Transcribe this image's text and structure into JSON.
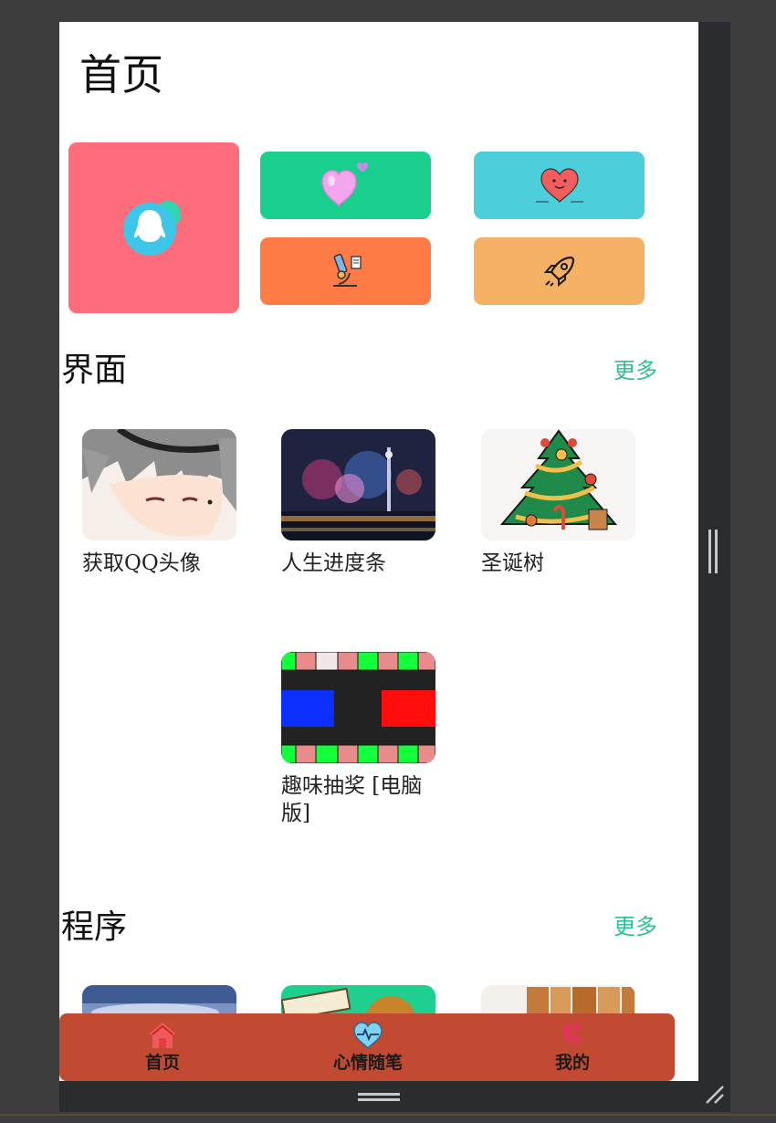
{
  "page": {
    "title": "首页"
  },
  "quick_tiles": [
    {
      "icon": "qq-penguin-icon",
      "color": "#fe6d7c"
    },
    {
      "icon": "pink-heart-icon",
      "color": "#19cf8e"
    },
    {
      "icon": "smiling-heart-icon",
      "color": "#4ccedb"
    },
    {
      "icon": "microscope-icon",
      "color": "#ff7b45"
    },
    {
      "icon": "rocket-icon",
      "color": "#f4b063"
    }
  ],
  "sections": {
    "ui": {
      "title": "界面",
      "more": "更多",
      "items": [
        {
          "label": "获取QQ头像"
        },
        {
          "label": "人生进度条"
        },
        {
          "label": "圣诞树"
        },
        {
          "label": "趣味抽奖 [电脑版]"
        }
      ]
    },
    "program": {
      "title": "程序",
      "more": "更多"
    }
  },
  "tabbar": {
    "color": "#c34a32",
    "tabs": [
      {
        "label": "首页",
        "icon": "home-icon"
      },
      {
        "label": "心情随笔",
        "icon": "heartbeat-icon"
      },
      {
        "label": "我的",
        "icon": "profile-icon"
      }
    ]
  },
  "accent_color": "#2fbf96"
}
